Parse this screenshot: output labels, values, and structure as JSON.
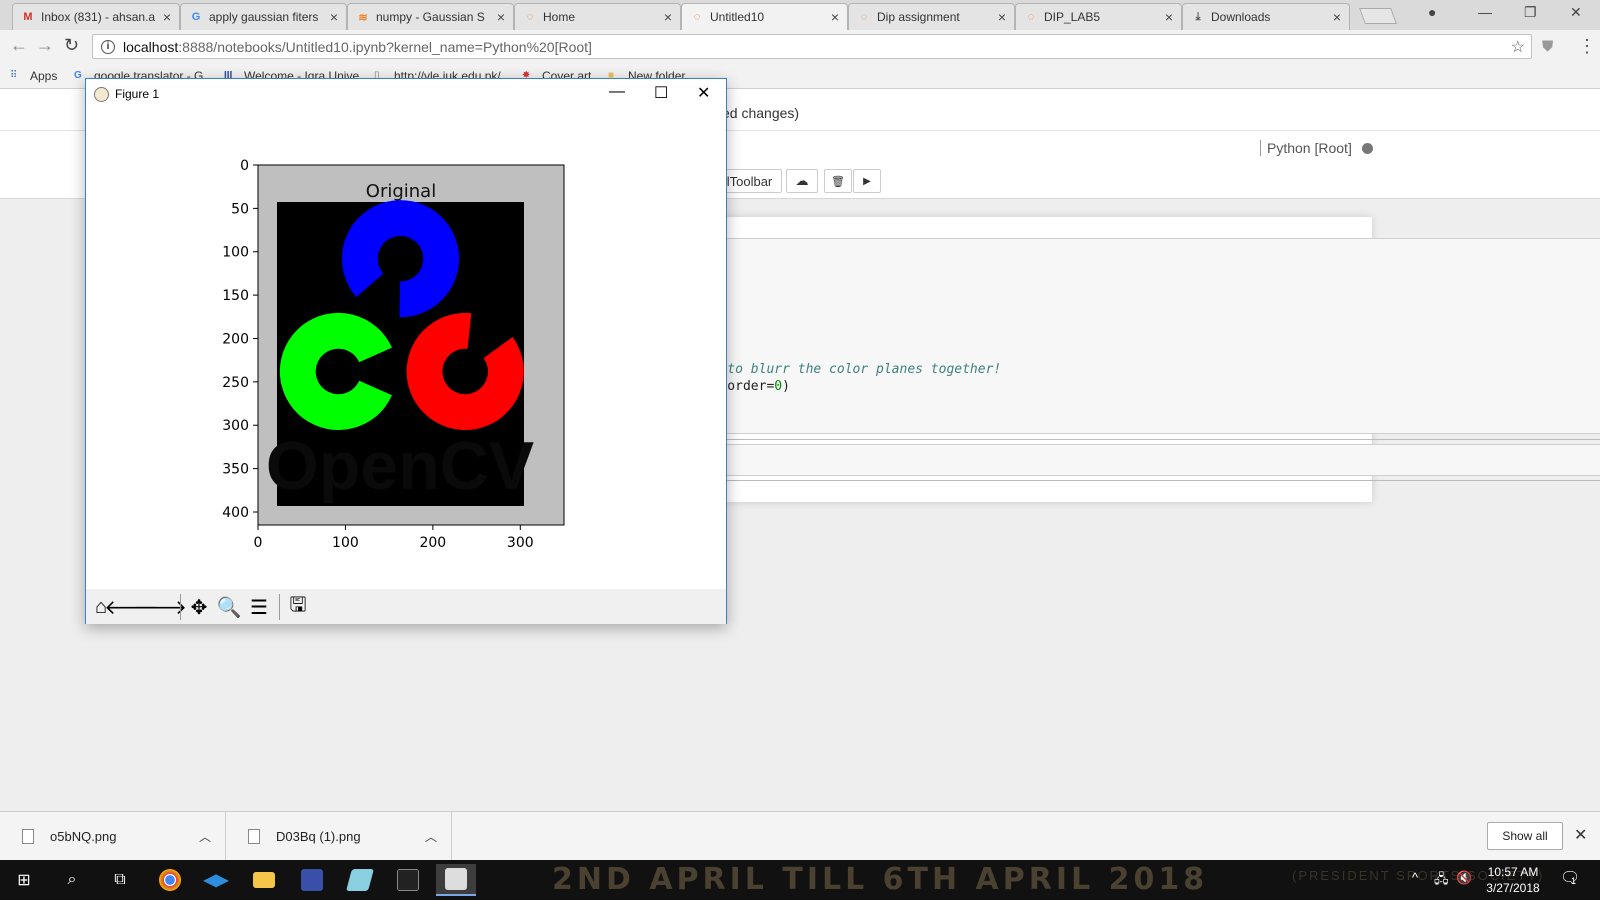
{
  "browser": {
    "tabs": [
      {
        "title": "Inbox (831) - ahsan.a",
        "icon": "gmail-icon",
        "color": "#d93025",
        "active": false
      },
      {
        "title": "apply gaussian fiters",
        "icon": "google-icon",
        "color": "#4285f4",
        "active": false
      },
      {
        "title": "numpy - Gaussian S",
        "icon": "stackoverflow-icon",
        "color": "#f48024",
        "active": false
      },
      {
        "title": "Home",
        "icon": "jupyter-icon",
        "color": "#f37726",
        "active": false
      },
      {
        "title": "Untitled10",
        "icon": "jupyter-icon",
        "color": "#f37726",
        "active": true
      },
      {
        "title": "Dip assignment",
        "icon": "jupyter-icon",
        "color": "#f37726",
        "active": false
      },
      {
        "title": "DIP_LAB5",
        "icon": "jupyter-icon",
        "color": "#f37726",
        "active": false
      },
      {
        "title": "Downloads",
        "icon": "download-icon",
        "color": "#555555",
        "active": false
      }
    ],
    "url_host": "localhost",
    "url_rest": ":8888/notebooks/Untitled10.ipynb?kernel_name=Python%20[Root]",
    "bookmarks": [
      {
        "label": "Apps",
        "icon": "apps-grid-icon"
      },
      {
        "label": "google translator - G",
        "icon": "google-icon"
      },
      {
        "label": "Welcome - Iqra Unive",
        "icon": "iqra-icon"
      },
      {
        "label": "http://vle.iuk.edu.pk/",
        "icon": "page-icon"
      },
      {
        "label": "Cover art",
        "icon": "cover-art-icon"
      },
      {
        "label": "New folder",
        "icon": "folder-icon"
      }
    ]
  },
  "jupyter": {
    "save_status": "ed changes)",
    "kernel": "Python [Root]",
    "toolbar_label": "lToolbar",
    "code_lines": [
      {
        "comment": "n't to blurr the color planes together!"
      },
      {
        "pre": "), order=",
        "num": "0",
        "post": ")",
        "num0": "0"
      }
    ]
  },
  "figure": {
    "window_title": "Figure 1",
    "toolbar_icons": [
      "home-icon",
      "back-arrow-icon",
      "forward-arrow-icon",
      "pan-icon",
      "zoom-icon",
      "subplots-config-icon",
      "save-icon"
    ]
  },
  "chart_data": {
    "type": "image",
    "title": "Original",
    "xlabel": "",
    "ylabel": "",
    "xlim": [
      0,
      350
    ],
    "ylim": [
      415,
      0
    ],
    "xticks": [
      0,
      100,
      200,
      300
    ],
    "yticks": [
      0,
      50,
      100,
      150,
      200,
      250,
      300,
      350,
      400
    ],
    "image_content": "OpenCV logo: blue, green and red rings on black over grey border",
    "colors": {
      "blue": "#0000ff",
      "green": "#00ff00",
      "red": "#ff0000",
      "border": "#bfbfbf",
      "background": "#000000"
    },
    "watermark_text": "OpenCV"
  },
  "downloads": [
    {
      "name": "o5bNQ.png"
    },
    {
      "name": "D03Bq (1).png"
    }
  ],
  "show_all": "Show all",
  "taskbar": {
    "time": "10:57 AM",
    "date": "3/27/2018",
    "wallpaper_text": "2ND APRIL TILL 6TH APRIL 2018",
    "wallpaper_text2": "(PRESIDENT SPORTS SOCIETY)",
    "notification_count": "1"
  }
}
